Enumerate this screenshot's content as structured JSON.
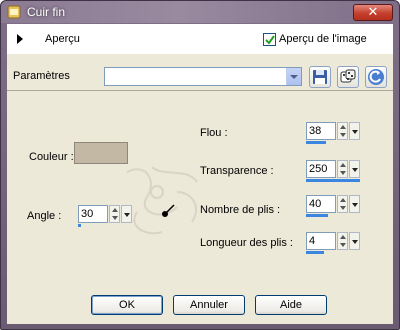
{
  "window": {
    "title": "Cuir fin",
    "close_label": "✕"
  },
  "preview": {
    "label": "Aperçu",
    "show_image_label": "Aperçu de l'image",
    "show_image_checked": true
  },
  "params": {
    "label": "Paramètres",
    "preset_value": ""
  },
  "fields": {
    "couleur": {
      "label": "Couleur :",
      "color": "#c2b8a3"
    },
    "angle": {
      "label": "Angle :",
      "value": "30"
    },
    "flou": {
      "label": "Flou :",
      "value": "38"
    },
    "transparence": {
      "label": "Transparence :",
      "value": "250"
    },
    "nombre_plis": {
      "label": "Nombre de plis :",
      "value": "40"
    },
    "longueur_plis": {
      "label": "Longueur des plis :",
      "value": "4"
    }
  },
  "buttons": {
    "ok": "OK",
    "cancel": "Annuler",
    "help": "Aide"
  },
  "colors": {
    "title_bar": "#8b7a92",
    "dialog_bg": "#ece9d8",
    "accent": "#3a86e0"
  }
}
